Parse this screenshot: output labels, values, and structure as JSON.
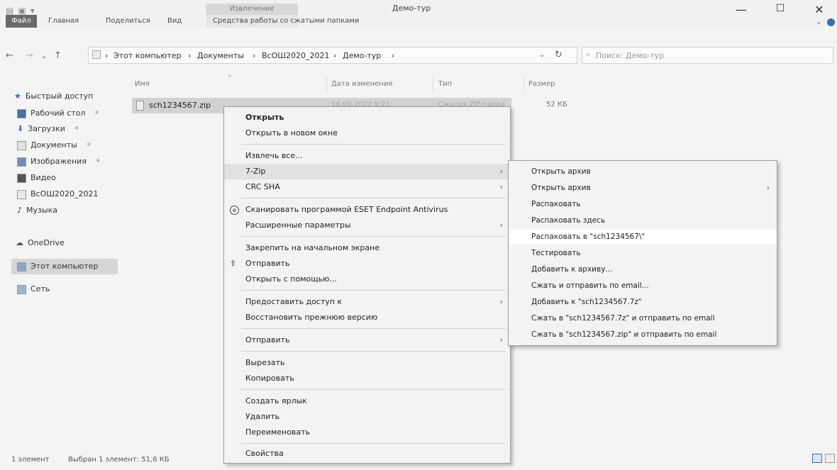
{
  "window": {
    "title": "Демо-тур",
    "tool_tab": "Извлечение",
    "controls": {
      "minimize": "—",
      "maximize": "☐",
      "close": "✕"
    }
  },
  "ribbon": {
    "tabs": [
      "Файл",
      "Главная",
      "Поделиться",
      "Вид",
      "Средства работы со сжатыми папками"
    ]
  },
  "address": {
    "crumbs": [
      "Этот компьютер",
      "Документы",
      "ВсОШ2020_2021",
      "Демо-тур"
    ],
    "search_placeholder": "Поиск: Демо-тур"
  },
  "sidebar": {
    "items": [
      {
        "label": "Быстрый доступ",
        "icon": "star-icon"
      },
      {
        "label": "Рабочий стол",
        "icon": "desktop-icon",
        "pinned": true
      },
      {
        "label": "Загрузки",
        "icon": "download-icon",
        "pinned": true
      },
      {
        "label": "Документы",
        "icon": "documents-icon",
        "pinned": true
      },
      {
        "label": "Изображения",
        "icon": "pictures-icon",
        "pinned": true
      },
      {
        "label": "Видео",
        "icon": "video-icon"
      },
      {
        "label": "ВсОШ2020_2021",
        "icon": "folder-icon"
      },
      {
        "label": "Музыка",
        "icon": "music-icon"
      },
      {
        "label": "OneDrive",
        "icon": "cloud-icon"
      },
      {
        "label": "Этот компьютер",
        "icon": "computer-icon",
        "selected": true
      },
      {
        "label": "Сеть",
        "icon": "network-icon"
      }
    ]
  },
  "columns": {
    "name": "Имя",
    "date": "Дата изменения",
    "type": "Тип",
    "size": "Размер"
  },
  "file": {
    "name": "sch1234567.zip",
    "date": "16.09.2020 9:21",
    "type": "Сжатая ZIP-папка",
    "size": "52 КБ"
  },
  "context_menu": {
    "items": [
      {
        "label": "Открыть",
        "bold": true
      },
      {
        "label": "Открыть в новом окне"
      },
      {
        "label": "Извлечь все..."
      },
      {
        "label": "7-Zip",
        "submenu": true,
        "highlight": true
      },
      {
        "label": "CRC SHA",
        "submenu": true
      },
      {
        "label": "Сканировать программой ESET Endpoint Antivirus",
        "icon": "eset-icon"
      },
      {
        "label": "Расширенные параметры",
        "submenu": true
      },
      {
        "label": "Закрепить на начальном экране"
      },
      {
        "label": "Отправить",
        "icon": "share-icon"
      },
      {
        "label": "Открыть с помощью..."
      },
      {
        "label": "Предоставить доступ к",
        "submenu": true
      },
      {
        "label": "Восстановить прежнюю версию"
      },
      {
        "label": "Отправить",
        "submenu": true
      },
      {
        "label": "Вырезать"
      },
      {
        "label": "Копировать"
      },
      {
        "label": "Создать ярлык"
      },
      {
        "label": "Удалить"
      },
      {
        "label": "Переименовать"
      },
      {
        "label": "Свойства"
      }
    ]
  },
  "submenu_7zip": {
    "items": [
      {
        "label": "Открыть архив"
      },
      {
        "label": "Открыть архив",
        "submenu": true
      },
      {
        "label": "Распаковать"
      },
      {
        "label": "Распаковать здесь"
      },
      {
        "label": "Распаковать в \"sch1234567\\\"",
        "highlight": true
      },
      {
        "label": "Тестировать"
      },
      {
        "label": "Добавить к архиву..."
      },
      {
        "label": "Сжать и отправить по email..."
      },
      {
        "label": "Добавить к \"sch1234567.7z\""
      },
      {
        "label": "Сжать в \"sch1234567.7z\" и отправить по email"
      },
      {
        "label": "Сжать в \"sch1234567.zip\" и отправить по email"
      }
    ]
  },
  "status": {
    "count": "1 элемент",
    "selection": "Выбран 1 элемент: 51,6 КБ"
  }
}
